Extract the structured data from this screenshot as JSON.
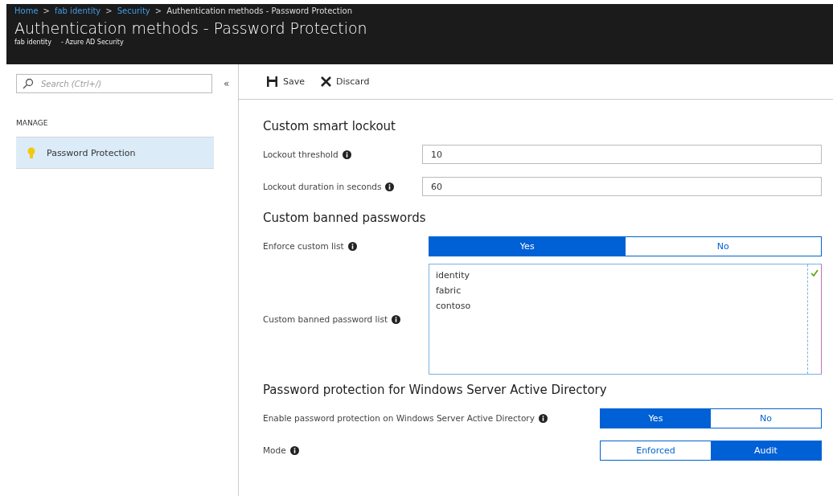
{
  "breadcrumb": {
    "separator": ">",
    "items": [
      {
        "label": "Home",
        "link": true
      },
      {
        "label": "fab identity",
        "link": true
      },
      {
        "label": "Security",
        "link": true
      },
      {
        "label": "Authentication methods - Password Protection",
        "link": false
      }
    ]
  },
  "title": "Authentication methods - Password Protection",
  "subtitle": [
    "fab identity",
    "- Azure AD Security"
  ],
  "sidebar": {
    "search": {
      "placeholder": "Search (Ctrl+/)"
    },
    "collapse": "«",
    "section": "MANAGE",
    "items": [
      {
        "label": "Password Protection",
        "selected": true
      }
    ]
  },
  "toolbar": [
    {
      "kind": "save",
      "label": "Save"
    },
    {
      "kind": "discard",
      "label": "Discard"
    }
  ],
  "sections": [
    {
      "heading": "Custom smart lockout",
      "rows": [
        {
          "kind": "input",
          "label": "Lockout threshold",
          "value": "10"
        },
        {
          "kind": "input",
          "label": "Lockout duration in seconds",
          "value": "60"
        }
      ]
    },
    {
      "heading": "Custom banned passwords",
      "rows": [
        {
          "kind": "toggle",
          "narrow": false,
          "label": "Enforce custom list",
          "options": [
            {
              "label": "Yes",
              "selected": true
            },
            {
              "label": "No",
              "selected": false
            }
          ]
        },
        {
          "kind": "list",
          "label": "Custom banned password list",
          "lines": [
            "identity",
            "fabric",
            "contoso"
          ],
          "valid": true
        }
      ]
    },
    {
      "heading": "Password protection for Windows Server Active Directory",
      "rows": [
        {
          "kind": "toggle",
          "narrow": true,
          "label": "Enable password protection on Windows Server Active Directory",
          "options": [
            {
              "label": "Yes",
              "selected": true
            },
            {
              "label": "No",
              "selected": false
            }
          ]
        },
        {
          "kind": "toggle",
          "narrow": true,
          "label": "Mode",
          "options": [
            {
              "label": "Enforced",
              "selected": false
            },
            {
              "label": "Audit",
              "selected": true
            }
          ]
        }
      ]
    }
  ]
}
